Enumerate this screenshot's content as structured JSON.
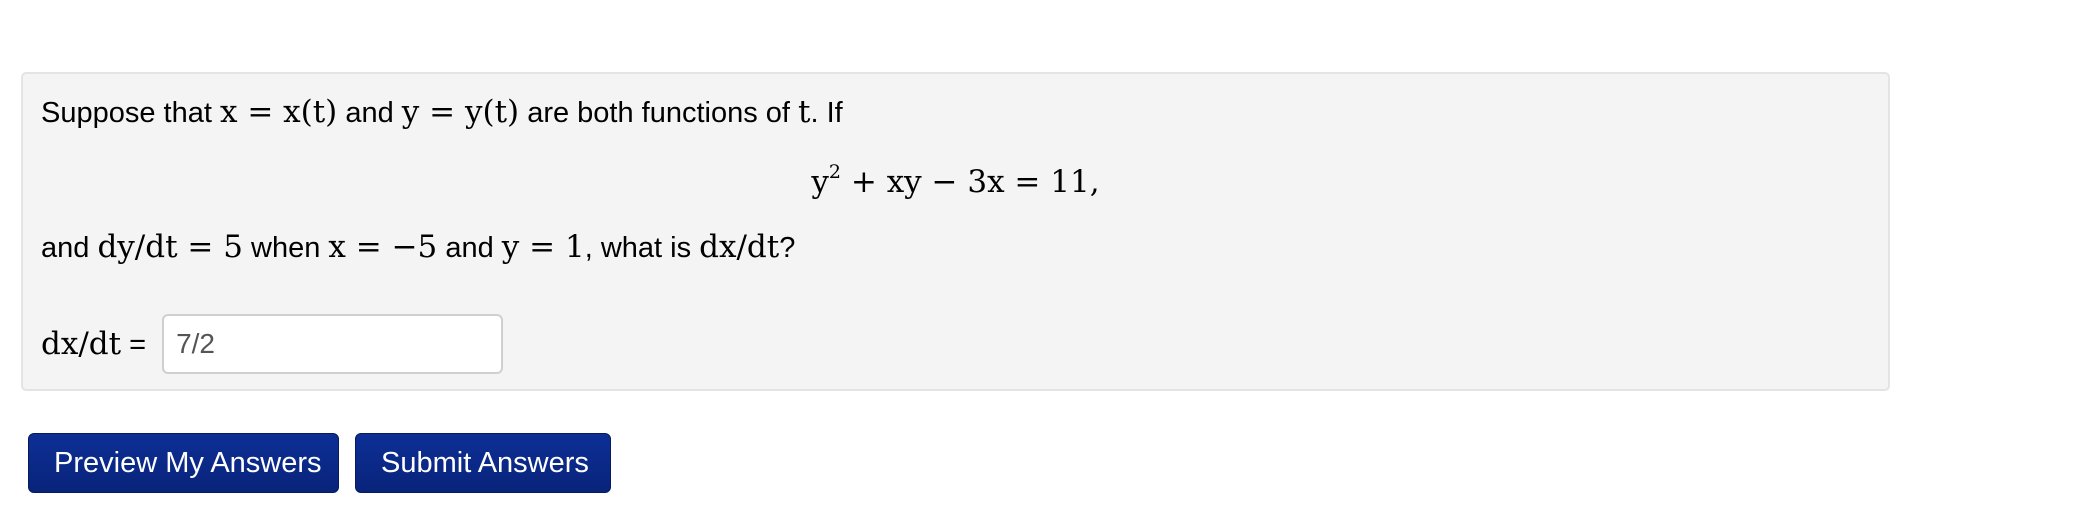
{
  "problem": {
    "line1": {
      "t1": "Suppose that ",
      "m1": "x = x(t)",
      "t2": " and ",
      "m2": "y = y(t)",
      "t3": " are both functions of ",
      "m3": "t",
      "t4": ". If"
    },
    "equation": {
      "base": "y",
      "exponent": "2",
      "rest": " + xy − 3x = 11,"
    },
    "line2": {
      "t1": "and ",
      "m1": "dy/dt = 5",
      "t2": " when ",
      "m2": "x = −5",
      "t3": " and ",
      "m3": "y = 1",
      "t4": ", what is ",
      "m4": "dx/dt",
      "t5": "?"
    },
    "answer": {
      "label_math": "dx/dt",
      "label_suffix": " =",
      "value": "7/2"
    }
  },
  "buttons": {
    "preview_label": "Preview My Answers",
    "submit_label": "Submit Answers",
    "color": "#0a2a8c"
  }
}
